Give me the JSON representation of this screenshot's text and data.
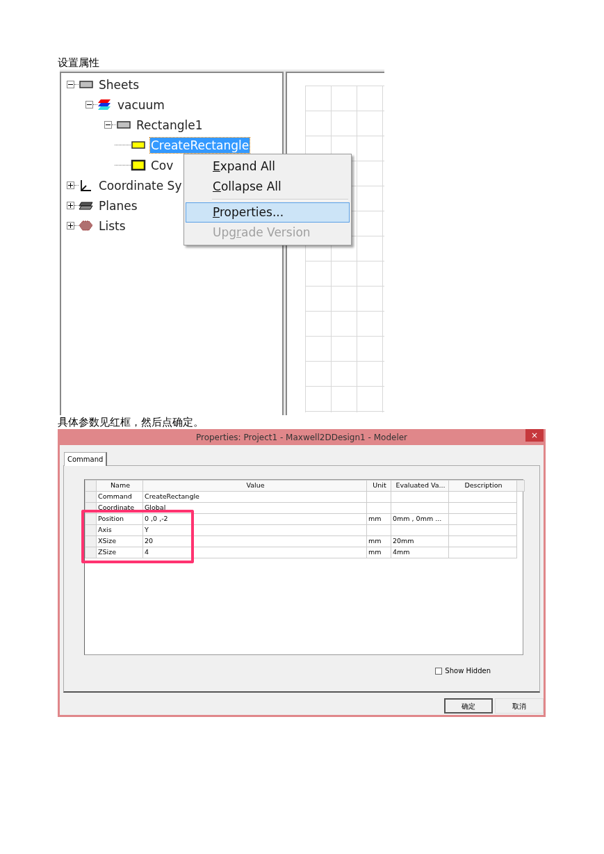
{
  "captions": [
    "设置属性",
    "具体参数见红框，然后点确定。"
  ],
  "tree": [
    {
      "label": "Sheets",
      "kind": "sheet",
      "expanded": true,
      "selected": false,
      "children": [
        {
          "label": "vacuum",
          "kind": "material",
          "expanded": true,
          "selected": false,
          "children": [
            {
              "label": "Rectangle1",
              "kind": "sheet",
              "expanded": true,
              "selected": false,
              "children": [
                {
                  "label": "CreateRectangle",
                  "kind": "yellow",
                  "selected": true
                },
                {
                  "label": "Cov",
                  "kind": "cover",
                  "selected": false
                }
              ]
            }
          ]
        }
      ]
    },
    {
      "label": "Coordinate Sy",
      "kind": "axes",
      "expanded": false,
      "selected": false
    },
    {
      "label": "Planes",
      "kind": "planes",
      "expanded": false,
      "selected": false
    },
    {
      "label": "Lists",
      "kind": "lists",
      "expanded": false,
      "selected": false
    }
  ],
  "context_menu": [
    {
      "kind": "item",
      "key": "E",
      "after": "xpand All",
      "selected": false,
      "disabled": false
    },
    {
      "kind": "item",
      "key": "C",
      "after": "ollapse All",
      "selected": false,
      "disabled": false
    },
    {
      "kind": "separator"
    },
    {
      "kind": "item",
      "key": "P",
      "after": "roperties...",
      "selected": true,
      "disabled": false
    },
    {
      "kind": "item",
      "before": "Upg",
      "key": "r",
      "after": "ade Version",
      "selected": false,
      "disabled": true
    }
  ],
  "dialog": {
    "title": "Properties: Project1 - Maxwell2DDesign1 - Modeler",
    "close": "×",
    "tabs": [
      {
        "label": "Command",
        "selected": true
      }
    ],
    "table": {
      "columns": [
        "Name",
        "Value",
        "Unit",
        "Evaluated Va...",
        "Description"
      ],
      "rows": [
        {
          "name": "Command",
          "value": "CreateRectangle",
          "unit": "",
          "evaluated": "",
          "highlighted": false
        },
        {
          "name": "Coordinate",
          "value": "Global",
          "unit": "",
          "evaluated": "",
          "highlighted": false
        },
        {
          "name": "Position",
          "value": "0 ,0 ,-2",
          "unit": "mm",
          "evaluated": "0mm , 0mm ...",
          "highlighted": true
        },
        {
          "name": "Axis",
          "value": "Y",
          "unit": "",
          "evaluated": "",
          "highlighted": true
        },
        {
          "name": "XSize",
          "value": "20",
          "unit": "mm",
          "evaluated": "20mm",
          "highlighted": true
        },
        {
          "name": "ZSize",
          "value": "4",
          "unit": "mm",
          "evaluated": "4mm",
          "highlighted": true
        }
      ]
    },
    "show_hidden": {
      "label": "Show Hidden",
      "checked": false
    },
    "buttons": [
      {
        "label": "确定",
        "default": true
      },
      {
        "label": "取消",
        "default": false
      }
    ]
  }
}
